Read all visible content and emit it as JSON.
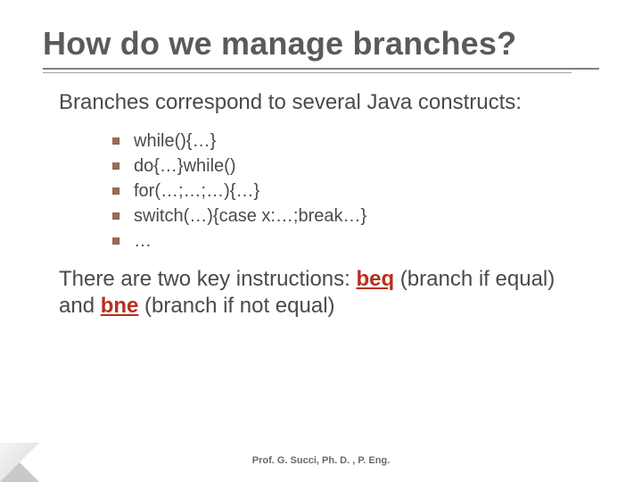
{
  "title": "How do we manage branches?",
  "intro": "Branches correspond to several Java constructs:",
  "items": [
    "while(){…}",
    "do{…}while()",
    "for(…;…;…){…}",
    "switch(…){case x:…;break…}",
    "…"
  ],
  "outro_pre": "There are two key instructions: ",
  "outro_kw1": "beq",
  "outro_mid1": " (branch if equal) and ",
  "outro_kw2": "bne",
  "outro_post": " (branch if not equal)",
  "footer": "Prof. G. Succi, Ph. D. , P. Eng."
}
